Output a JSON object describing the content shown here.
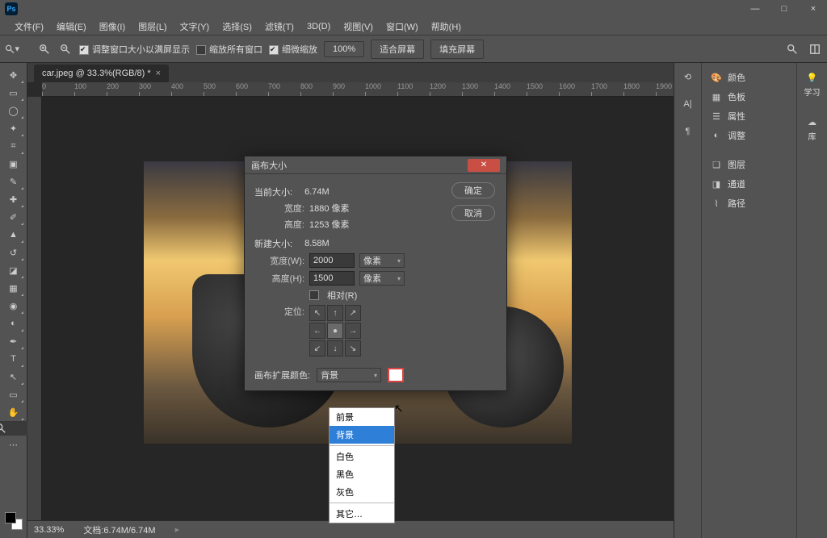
{
  "menu": {
    "file": "文件(F)",
    "edit": "编辑(E)",
    "image": "图像(I)",
    "layer": "图层(L)",
    "type": "文字(Y)",
    "select": "选择(S)",
    "filter": "滤镜(T)",
    "threed": "3D(D)",
    "view": "视图(V)",
    "window": "窗口(W)",
    "help": "帮助(H)"
  },
  "optbar": {
    "resize": "调整窗口大小以满屏显示",
    "zoomall": "缩放所有窗口",
    "scrubby": "细微缩放",
    "pct": "100%",
    "fit": "适合屏幕",
    "fill": "填充屏幕"
  },
  "tab": {
    "name": "car.jpeg @ 33.3%(RGB/8) *"
  },
  "ruler": {
    "ticks": [
      "0",
      "100",
      "200",
      "300",
      "400",
      "500",
      "600",
      "700",
      "800",
      "900",
      "1000",
      "1100",
      "1200",
      "1300",
      "1400",
      "1500",
      "1600",
      "1700",
      "1800",
      "1900"
    ]
  },
  "status": {
    "zoom": "33.33%",
    "doc": "文档:6.74M/6.74M"
  },
  "panels": {
    "color": "颜色",
    "swatches": "色板",
    "properties": "属性",
    "adjustments": "调整",
    "layers": "图层",
    "channels": "通道",
    "paths": "路径",
    "learn": "学习",
    "library": "库"
  },
  "dlg": {
    "title": "画布大小",
    "current_label": "当前大小:",
    "current_val": "6.74M",
    "cw_label": "宽度:",
    "cw_val": "1880 像素",
    "ch_label": "高度:",
    "ch_val": "1253 像素",
    "new_label": "新建大小:",
    "new_val": "8.58M",
    "w_label": "宽度(W):",
    "w_val": "2000",
    "h_label": "高度(H):",
    "h_val": "1500",
    "unit": "像素",
    "relative": "相对(R)",
    "anchor": "定位:",
    "ext_label": "画布扩展颜色:",
    "ext_val": "背景",
    "ok": "确定",
    "cancel": "取消"
  },
  "dd": {
    "fg": "前景",
    "bg": "背景",
    "white": "白色",
    "black": "黑色",
    "gray": "灰色",
    "other": "其它…"
  }
}
